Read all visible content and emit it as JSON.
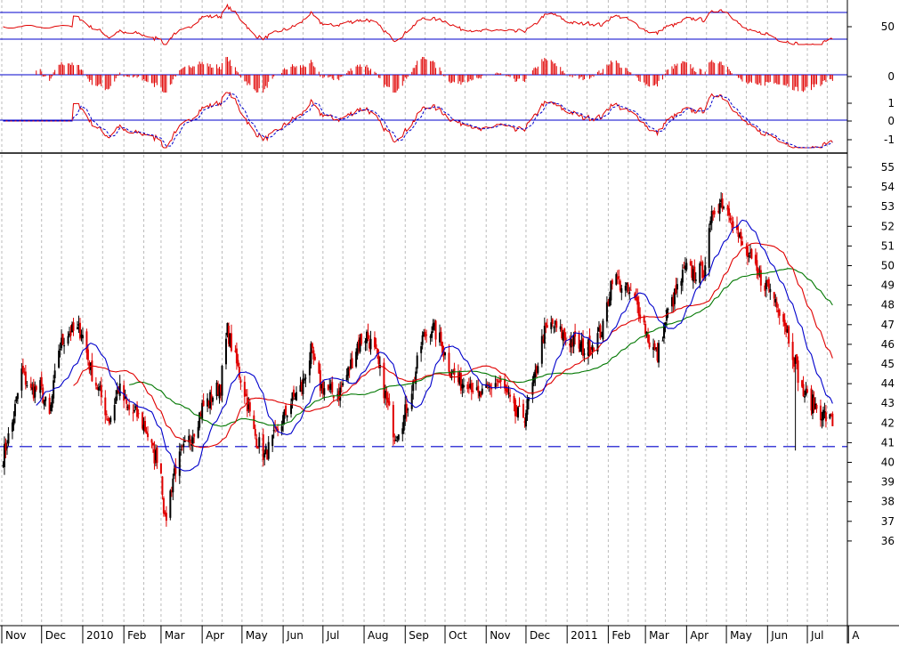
{
  "chart_data": {
    "type": "candlestick",
    "title": "",
    "colors": {
      "up": "#000000",
      "down": "#e00000",
      "ma_fast": "#0000cc",
      "ma_mid": "#e00000",
      "ma_slow": "#007700",
      "support": "#0000cc",
      "grid": "#bbbbbb",
      "indicator_line": "#0000cc",
      "indicator_series": "#e00000"
    },
    "x_axis": {
      "month_labels": [
        "Nov",
        "Dec",
        "2010",
        "Feb",
        "Mar",
        "Apr",
        "May",
        "Jun",
        "Jul",
        "Aug",
        "Sep",
        "Oct",
        "Nov",
        "Dec",
        "2011",
        "Feb",
        "Mar",
        "Apr",
        "May",
        "Jun",
        "Jul",
        "A"
      ],
      "range": [
        "2009-11",
        "2011-08"
      ]
    },
    "y_axis": {
      "range": [
        35.5,
        55.5
      ],
      "tick_labels": [
        "55",
        "54",
        "53",
        "52",
        "51",
        "50",
        "49",
        "48",
        "47",
        "46",
        "45",
        "44",
        "43",
        "42",
        "41",
        "40",
        "39",
        "38",
        "37",
        "36"
      ],
      "grid": true
    },
    "support_level": 40.8,
    "price_anchors": [
      [
        "2009-11-02",
        40.3
      ],
      [
        "2009-11-09",
        42.0
      ],
      [
        "2009-11-16",
        44.6
      ],
      [
        "2009-11-23",
        43.6
      ],
      [
        "2009-11-30",
        43.8
      ],
      [
        "2009-12-07",
        42.3
      ],
      [
        "2009-12-14",
        45.8
      ],
      [
        "2009-12-21",
        46.6
      ],
      [
        "2009-12-31",
        46.7
      ],
      [
        "2010-01-07",
        44.7
      ],
      [
        "2010-01-14",
        43.5
      ],
      [
        "2010-01-21",
        42.1
      ],
      [
        "2010-01-28",
        43.8
      ],
      [
        "2010-02-04",
        42.7
      ],
      [
        "2010-02-11",
        42.4
      ],
      [
        "2010-02-18",
        41.6
      ],
      [
        "2010-02-24",
        40.3
      ],
      [
        "2010-02-28",
        40.4
      ],
      [
        "2010-03-04",
        36.9
      ],
      [
        "2010-03-11",
        39.6
      ],
      [
        "2010-03-18",
        40.6
      ],
      [
        "2010-03-25",
        41.5
      ],
      [
        "2010-04-01",
        42.8
      ],
      [
        "2010-04-08",
        43.3
      ],
      [
        "2010-04-15",
        44.0
      ],
      [
        "2010-04-20",
        46.7
      ],
      [
        "2010-04-26",
        45.2
      ],
      [
        "2010-05-03",
        43.6
      ],
      [
        "2010-05-10",
        41.5
      ],
      [
        "2010-05-18",
        40.3
      ],
      [
        "2010-05-25",
        41.2
      ],
      [
        "2010-06-01",
        42.2
      ],
      [
        "2010-06-08",
        43.2
      ],
      [
        "2010-06-15",
        43.8
      ],
      [
        "2010-06-22",
        45.6
      ],
      [
        "2010-06-29",
        43.9
      ],
      [
        "2010-07-06",
        43.6
      ],
      [
        "2010-07-13",
        43.5
      ],
      [
        "2010-07-20",
        44.6
      ],
      [
        "2010-07-27",
        46.0
      ],
      [
        "2010-08-03",
        46.5
      ],
      [
        "2010-08-10",
        45.4
      ],
      [
        "2010-08-17",
        43.4
      ],
      [
        "2010-08-24",
        41.4
      ],
      [
        "2010-08-31",
        42.3
      ],
      [
        "2010-09-07",
        44.0
      ],
      [
        "2010-09-14",
        46.3
      ],
      [
        "2010-09-21",
        46.9
      ],
      [
        "2010-09-28",
        46.1
      ],
      [
        "2010-10-05",
        44.7
      ],
      [
        "2010-10-12",
        44.0
      ],
      [
        "2010-10-19",
        44.2
      ],
      [
        "2010-10-26",
        43.3
      ],
      [
        "2010-11-02",
        43.6
      ],
      [
        "2010-11-09",
        44.2
      ],
      [
        "2010-11-16",
        43.5
      ],
      [
        "2010-11-23",
        42.4
      ],
      [
        "2010-11-30",
        42.4
      ],
      [
        "2010-12-07",
        44.1
      ],
      [
        "2010-12-14",
        46.5
      ],
      [
        "2010-12-21",
        47.0
      ],
      [
        "2010-12-31",
        46.3
      ],
      [
        "2011-01-07",
        46.1
      ],
      [
        "2011-01-14",
        45.7
      ],
      [
        "2011-01-21",
        46.1
      ],
      [
        "2011-01-28",
        46.8
      ],
      [
        "2011-02-04",
        49.5
      ],
      [
        "2011-02-11",
        49.0
      ],
      [
        "2011-02-18",
        48.5
      ],
      [
        "2011-02-25",
        47.7
      ],
      [
        "2011-03-04",
        46.1
      ],
      [
        "2011-03-10",
        45.4
      ],
      [
        "2011-03-17",
        47.5
      ],
      [
        "2011-03-24",
        48.6
      ],
      [
        "2011-03-31",
        49.8
      ],
      [
        "2011-04-07",
        49.6
      ],
      [
        "2011-04-14",
        49.8
      ],
      [
        "2011-04-21",
        52.8
      ],
      [
        "2011-04-27",
        53.3
      ],
      [
        "2011-05-04",
        52.7
      ],
      [
        "2011-05-11",
        51.3
      ],
      [
        "2011-05-18",
        50.4
      ],
      [
        "2011-05-25",
        49.4
      ],
      [
        "2011-06-01",
        49.0
      ],
      [
        "2011-06-08",
        48.2
      ],
      [
        "2011-06-15",
        46.9
      ],
      [
        "2011-06-20",
        45.6
      ],
      [
        "2011-06-27",
        43.6
      ],
      [
        "2011-07-05",
        43.0
      ],
      [
        "2011-07-12",
        42.5
      ],
      [
        "2011-07-20",
        42.0
      ]
    ],
    "panels": [
      {
        "name": "oscillator-1",
        "tick_labels": [
          "50"
        ],
        "reference_lines": [
          63,
          36
        ]
      },
      {
        "name": "histogram",
        "tick_labels": [
          "0"
        ],
        "reference_lines": [
          0
        ]
      },
      {
        "name": "oscillator-2",
        "tick_labels": [
          "1",
          "0",
          "-1"
        ],
        "reference_lines": [
          0
        ]
      }
    ]
  }
}
